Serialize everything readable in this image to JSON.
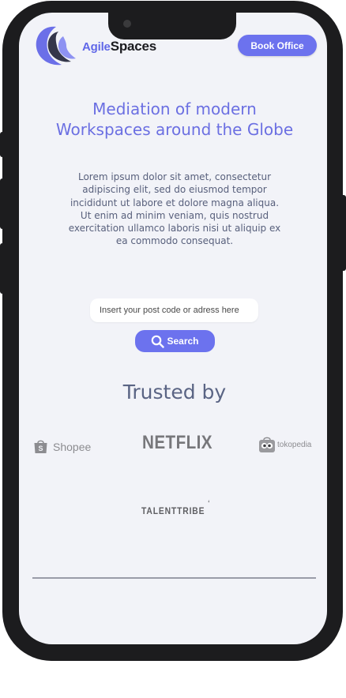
{
  "header": {
    "brand_part1": "Agile",
    "brand_part2": "Spaces",
    "book_button": "Book Office",
    "colors": {
      "accent": "#6c72ee",
      "brand_dark": "#1b1b1f"
    }
  },
  "hero": {
    "title": "Mediation of modern Workspaces around the Globe",
    "body": "Lorem ipsum dolor sit amet, consectetur adipiscing elit, sed do eiusmod tempor incididunt ut labore et dolore magna aliqua. Ut enim ad minim veniam, quis nostrud exercitation ullamco laboris nisi ut aliquip ex ea commodo consequat."
  },
  "search": {
    "placeholder": "Insert your post code or adress here",
    "button_label": "Search",
    "button_icon": "search-icon"
  },
  "trusted": {
    "heading": "Trusted by",
    "logos": [
      {
        "name": "Shopee",
        "icon": "shopping-bag-icon"
      },
      {
        "name": "NETFLIX"
      },
      {
        "name": "tokopedia",
        "icon": "owl-icon"
      },
      {
        "name": "TALENTTRIBE"
      }
    ]
  }
}
